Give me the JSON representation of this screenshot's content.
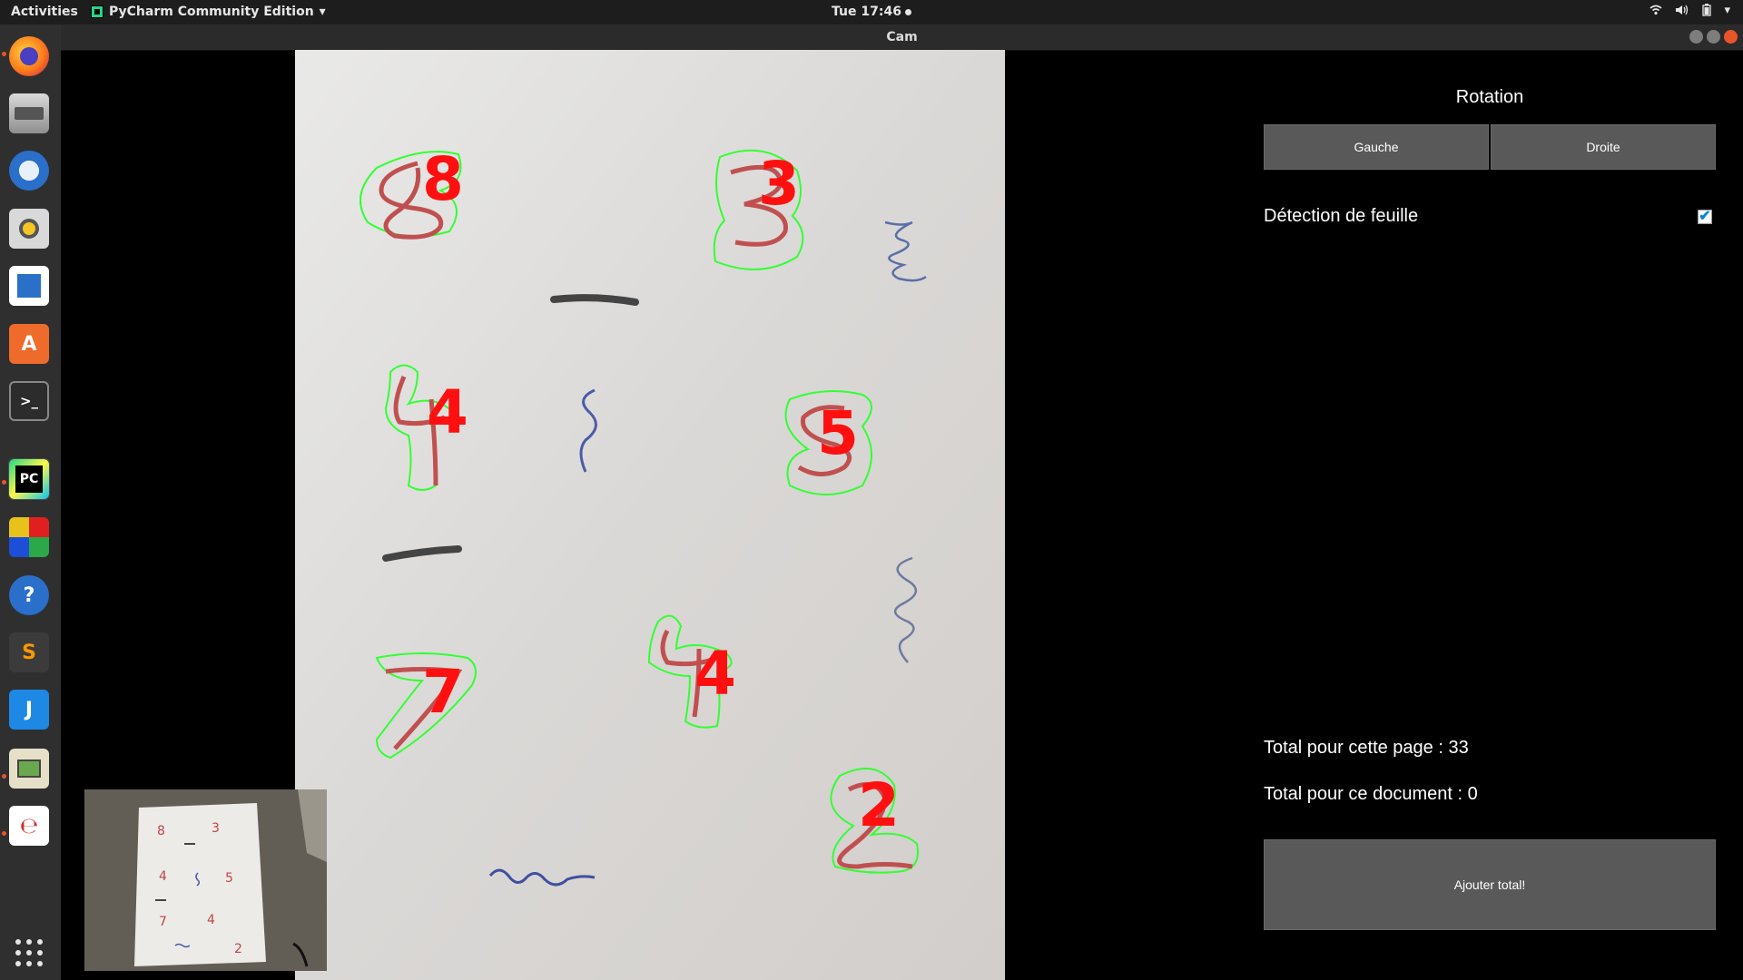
{
  "topbar": {
    "activities": "Activities",
    "app_name": "PyCharm Community Edition",
    "clock": "Tue 17:46"
  },
  "window": {
    "title": "Cam"
  },
  "dock": {
    "items": [
      "firefox-icon",
      "files-icon",
      "thunderbird-icon",
      "rhythmbox-icon",
      "libreoffice-writer-icon",
      "software-center-icon",
      "terminal-icon",
      "pycharm-icon",
      "windows-app-icon",
      "help-icon",
      "sublime-text-icon",
      "jetbrains-j-icon",
      "image-viewer-icon",
      "evince-icon",
      "show-applications-icon"
    ]
  },
  "camera": {
    "detected_digits": [
      "8",
      "3",
      "4",
      "5",
      "7",
      "4",
      "2"
    ]
  },
  "panel": {
    "rotation_title": "Rotation",
    "left_button": "Gauche",
    "right_button": "Droite",
    "sheet_detection_label": "Détection de feuille",
    "sheet_detection_checked": true,
    "page_total": "Total pour cette page : 33",
    "document_total": "Total pour ce document : 0",
    "add_total_button": "Ajouter total!"
  },
  "colors": {
    "contour": "#33ff33",
    "digit_label": "#ff1010",
    "button_bg": "#595959",
    "accent": "#e9542b"
  }
}
